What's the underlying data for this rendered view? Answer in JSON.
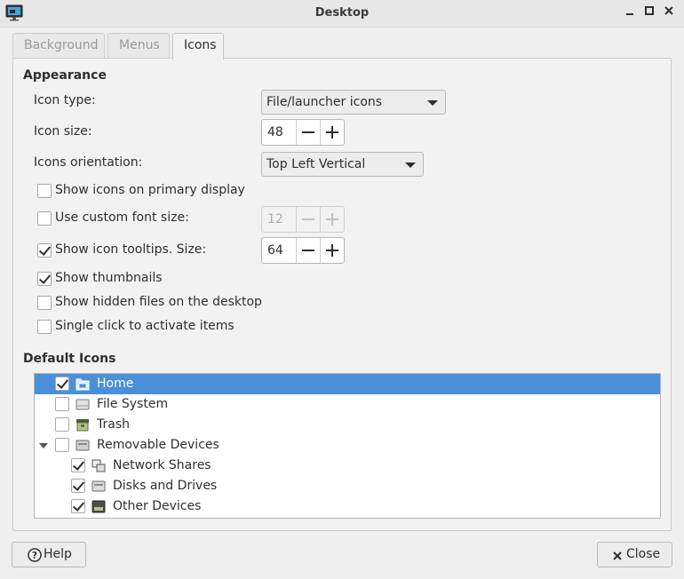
{
  "window": {
    "title": "Desktop",
    "controls": [
      "minimize",
      "maximize",
      "close"
    ]
  },
  "tabs": [
    {
      "label": "Background",
      "active": false
    },
    {
      "label": "Menus",
      "active": false
    },
    {
      "label": "Icons",
      "active": true
    }
  ],
  "appearance": {
    "title": "Appearance",
    "icon_type": {
      "label": "Icon type:",
      "value": "File/launcher icons"
    },
    "icon_size": {
      "label": "Icon size:",
      "value": "48"
    },
    "icons_orientation": {
      "label": "Icons orientation:",
      "value": "Top Left Vertical"
    },
    "show_on_primary": {
      "label": "Show icons on primary display",
      "checked": false
    },
    "custom_font_size": {
      "label": "Use custom font size:",
      "checked": false,
      "value": "12"
    },
    "tooltips": {
      "label": "Show icon tooltips. Size:",
      "checked": true,
      "value": "64"
    },
    "thumbnails": {
      "label": "Show thumbnails",
      "checked": true
    },
    "hidden_files": {
      "label": "Show hidden files on the desktop",
      "checked": false
    },
    "single_click": {
      "label": "Single click to activate items",
      "checked": false
    }
  },
  "default_icons": {
    "title": "Default Icons",
    "items": [
      {
        "label": "Home",
        "checked": true,
        "selected": true,
        "icon": "home-folder-icon"
      },
      {
        "label": "File System",
        "checked": false,
        "icon": "drive-icon"
      },
      {
        "label": "Trash",
        "checked": false,
        "icon": "trash-icon"
      },
      {
        "label": "Removable Devices",
        "checked": false,
        "expanded": true,
        "icon": "removable-drive-icon"
      },
      {
        "label": "Network Shares",
        "checked": true,
        "icon": "network-share-icon"
      },
      {
        "label": "Disks and Drives",
        "checked": true,
        "icon": "disk-icon"
      },
      {
        "label": "Other Devices",
        "checked": true,
        "icon": "device-icon"
      }
    ]
  },
  "footer": {
    "help_label": "Help",
    "close_label": "Close"
  },
  "colors": {
    "selection": "#4a90d9",
    "window_bg": "#efefef"
  }
}
